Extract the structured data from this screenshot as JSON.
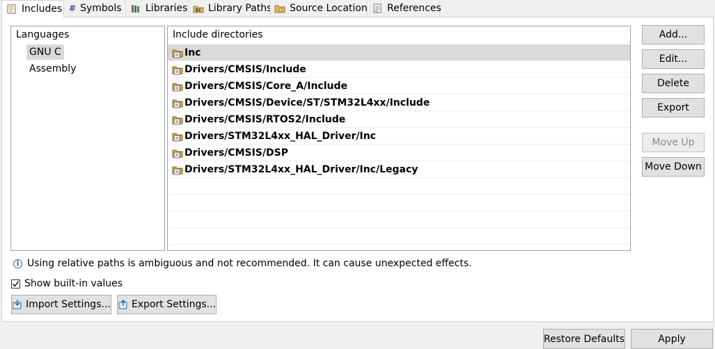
{
  "tabs": [
    {
      "label": "Includes",
      "icon": "includes-icon",
      "active": true
    },
    {
      "label": "Symbols",
      "icon": "hash-icon"
    },
    {
      "label": "Libraries",
      "icon": "libraries-icon"
    },
    {
      "label": "Library Paths",
      "icon": "library-paths-icon"
    },
    {
      "label": "Source Location",
      "icon": "folder-icon"
    },
    {
      "label": "References",
      "icon": "references-icon"
    }
  ],
  "languages": {
    "header": "Languages",
    "items": [
      "GNU C",
      "Assembly"
    ],
    "selected": "GNU C"
  },
  "includes": {
    "header": "Include directories",
    "items": [
      "Inc",
      "Drivers/CMSIS/Include",
      "Drivers/CMSIS/Core_A/Include",
      "Drivers/CMSIS/Device/ST/STM32L4xx/Include",
      "Drivers/CMSIS/RTOS2/Include",
      "Drivers/STM32L4xx_HAL_Driver/Inc",
      "Drivers/CMSIS/DSP",
      "Drivers/STM32L4xx_HAL_Driver/Inc/Legacy"
    ],
    "selected": "Inc"
  },
  "side_buttons": {
    "add": "Add...",
    "edit": "Edit...",
    "delete": "Delete",
    "export": "Export",
    "move_up": "Move Up",
    "move_down": "Move Down"
  },
  "info_text": "Using relative paths is ambiguous and not recommended. It can cause unexpected effects.",
  "show_builtin": {
    "label": "Show built-in values",
    "checked": true
  },
  "settings_buttons": {
    "import": "Import Settings...",
    "export": "Export Settings..."
  },
  "bottom_buttons": {
    "restore_defaults": "Restore Defaults",
    "apply": "Apply"
  },
  "colors": {
    "selection": "#d9d9d9",
    "info_accent": "#2a63b8",
    "folder_icon": "#d9a441"
  }
}
